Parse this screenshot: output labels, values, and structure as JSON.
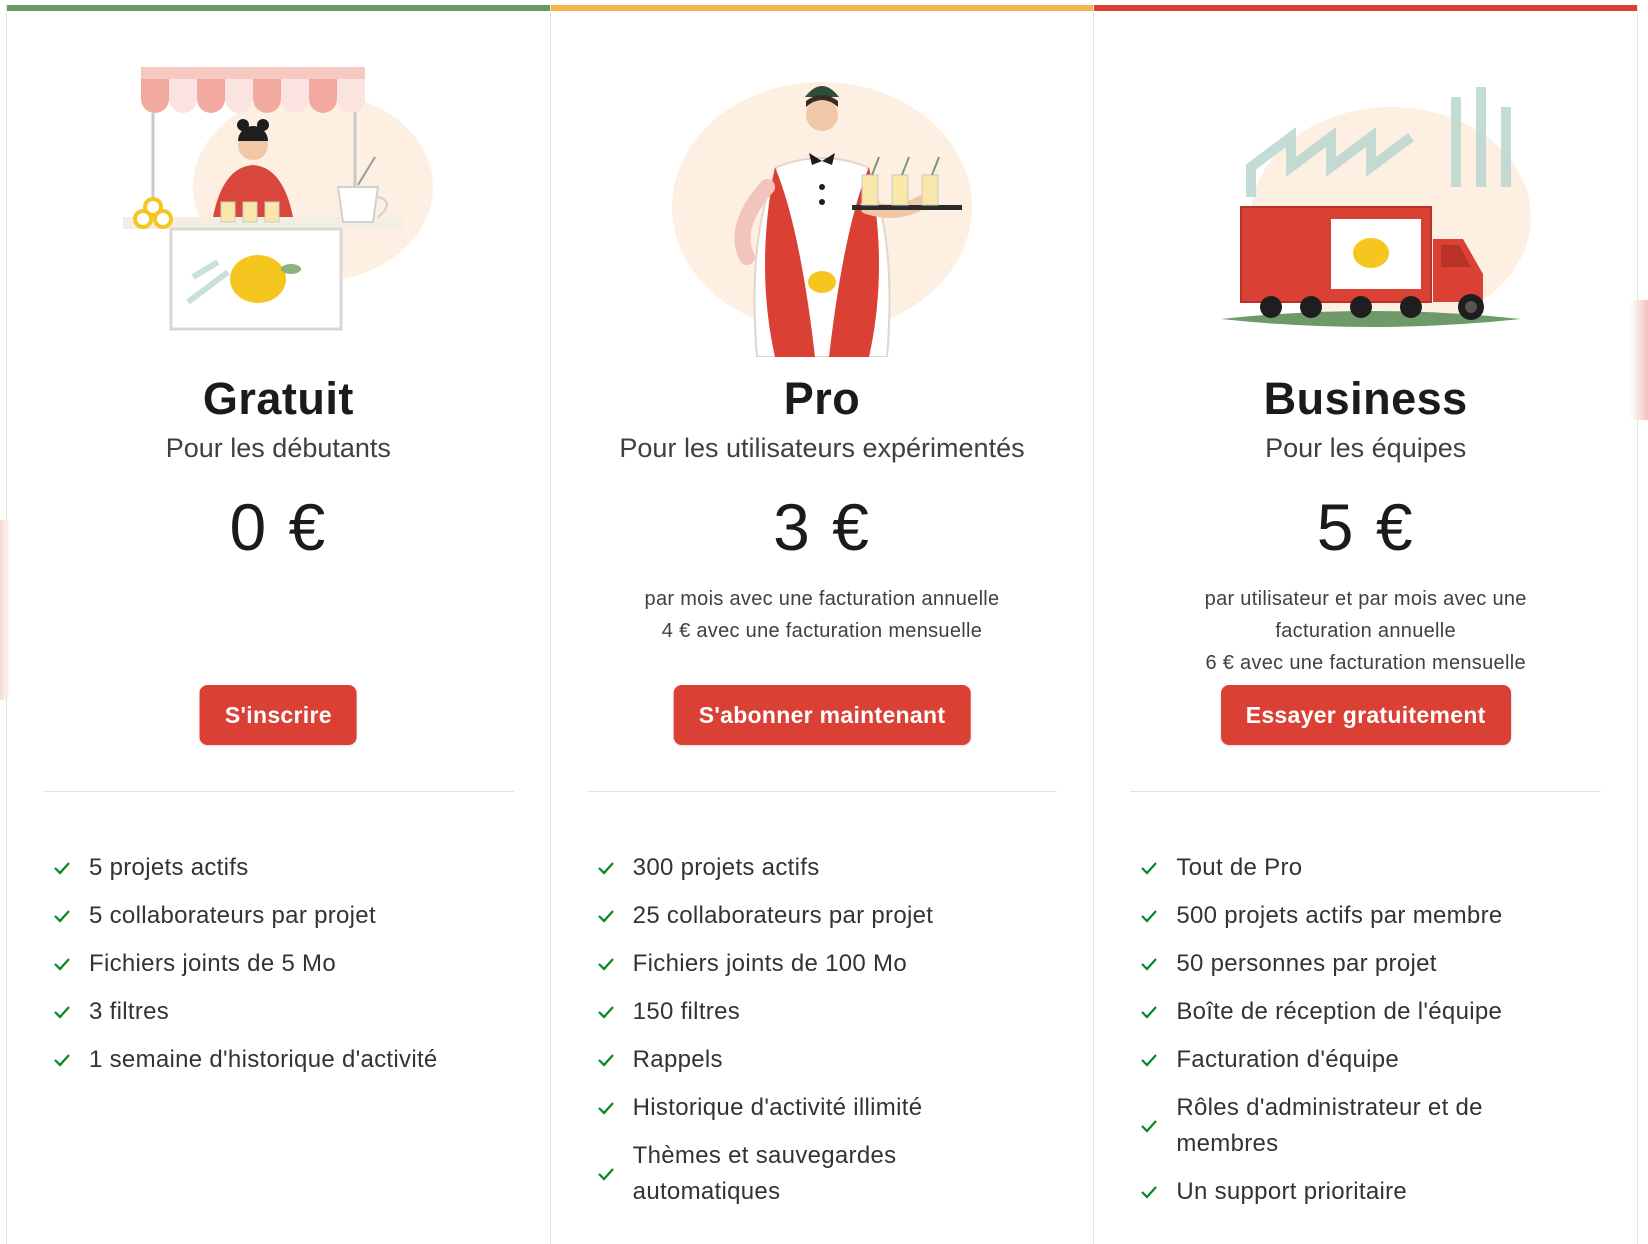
{
  "colors": {
    "accent": "#db4035",
    "check": "#058527",
    "bar_free": "#6a9a5e",
    "bar_pro": "#f2b44b",
    "bar_business": "#db4035"
  },
  "plans": [
    {
      "name": "Gratuit",
      "subtitle": "Pour les débutants",
      "price": "0 €",
      "billing": [],
      "cta": "S'inscrire",
      "illustration": "lemonade-stand-illustration",
      "features": [
        "5 projets actifs",
        "5 collaborateurs par projet",
        "Fichiers joints de 5 Mo",
        "3 filtres",
        "1 semaine d'historique d'activité"
      ]
    },
    {
      "name": "Pro",
      "subtitle": "Pour les utilisateurs expérimentés",
      "price": "3 €",
      "billing": [
        "par mois avec une facturation annuelle",
        "4 € avec une facturation mensuelle"
      ],
      "cta": "S'abonner maintenant",
      "illustration": "waiter-with-lemonade-tray-illustration",
      "features": [
        "300 projets actifs",
        "25 collaborateurs par projet",
        "Fichiers joints de 100 Mo",
        "150 filtres",
        "Rappels",
        "Historique d'activité illimité",
        "Thèmes et sauvegardes automatiques"
      ]
    },
    {
      "name": "Business",
      "subtitle": "Pour les équipes",
      "price": "5 €",
      "billing": [
        "par utilisateur et par mois avec une",
        "facturation annuelle",
        "6 € avec une facturation mensuelle"
      ],
      "cta": "Essayer gratuitement",
      "illustration": "delivery-truck-factory-illustration",
      "features": [
        "Tout de Pro",
        "500 projets actifs par membre",
        "50 personnes par projet",
        "Boîte de réception de l'équipe",
        "Facturation d'équipe",
        "Rôles d'administrateur et de membres",
        "Un support prioritaire"
      ]
    }
  ]
}
